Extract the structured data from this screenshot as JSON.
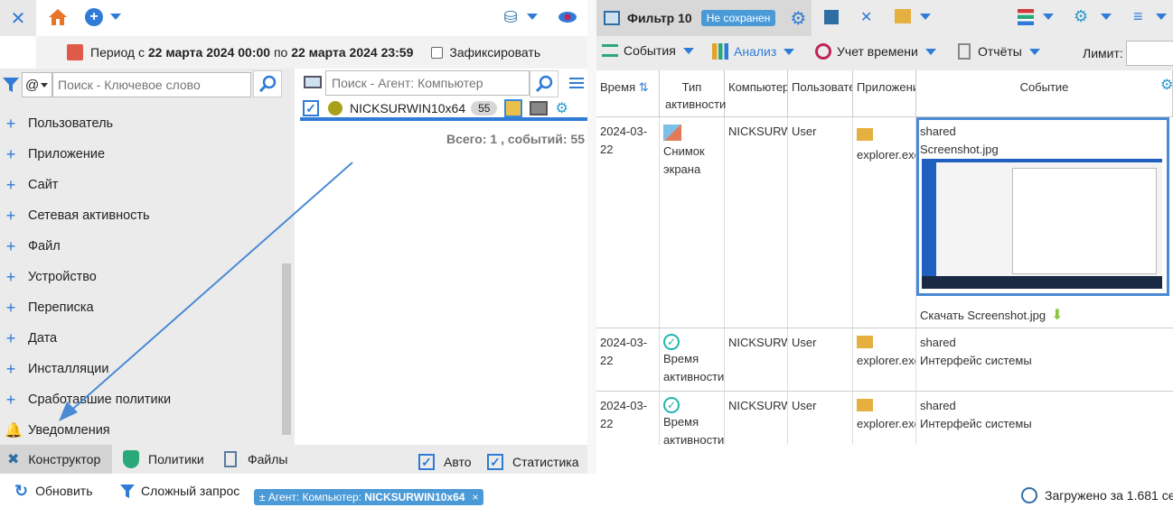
{
  "left_top": {
    "period_prefix": "Период с",
    "date_from": "22 марта 2024 00:00",
    "period_mid": "по",
    "date_to": "22 марта 2024 23:59",
    "fix_label": "Зафиксировать"
  },
  "search": {
    "keyword_placeholder": "Поиск - Ключевое слово",
    "at_option": "@",
    "agent_placeholder": "Поиск - Агент: Компьютер"
  },
  "agent": {
    "name": "NICKSURWIN10x64",
    "count": "55",
    "total": "Всего: 1 , событий: 55"
  },
  "sidebar": {
    "items": [
      {
        "label": "Пользователь"
      },
      {
        "label": "Приложение"
      },
      {
        "label": "Сайт"
      },
      {
        "label": "Сетевая активность"
      },
      {
        "label": "Файл"
      },
      {
        "label": "Устройство"
      },
      {
        "label": "Переписка"
      },
      {
        "label": "Дата"
      },
      {
        "label": "Инсталляции"
      },
      {
        "label": "Сработавшие политики"
      },
      {
        "label": "Уведомления"
      }
    ]
  },
  "bottom_tabs": {
    "constructor": "Конструктор",
    "policies": "Политики",
    "files": "Файлы",
    "auto": "Авто",
    "stats": "Статистика"
  },
  "filter": {
    "title": "Фильтр 10",
    "badge": "Не сохранен"
  },
  "menu": {
    "events": "События",
    "analysis": "Анализ",
    "time": "Учет времени",
    "reports": "Отчёты",
    "limit_label": "Лимит:"
  },
  "columns": [
    "Время",
    "Тип",
    "Компьютер",
    "Пользовате",
    "Приложени",
    "Событие"
  ],
  "rows": [
    {
      "time": "2024-03-22",
      "type1": "Снимок",
      "type2": "экрана",
      "computer": "NICKSURW",
      "user": "User",
      "app": "explorer.exe",
      "event1": "shared",
      "event2": "Screenshot.jpg",
      "download": "Скачать Screenshot.jpg"
    },
    {
      "time": "2024-03-22",
      "type1": "Время",
      "type2": "активности",
      "computer": "NICKSURW",
      "user": "User",
      "app": "explorer.exe",
      "event1": "shared",
      "event2": "Интерфейс системы"
    },
    {
      "time": "2024-03-22",
      "type1": "Время",
      "type2": "активности",
      "computer": "NICKSURW",
      "user": "User",
      "app": "explorer.exe",
      "event1": "shared",
      "event2": "Интерфейс системы"
    }
  ],
  "partial_top_type": "активности",
  "status": {
    "refresh": "Обновить",
    "complex": "Сложный запрос",
    "filter_tag_prefix": "± Агент: Компьютер:",
    "filter_tag_value": "NICKSURWIN10x64",
    "loaded": "Загружено за 1.681 се"
  },
  "colors": {
    "accent": "#2f7bd6",
    "badge": "#4a9ad8",
    "green": "#2aa87a"
  }
}
